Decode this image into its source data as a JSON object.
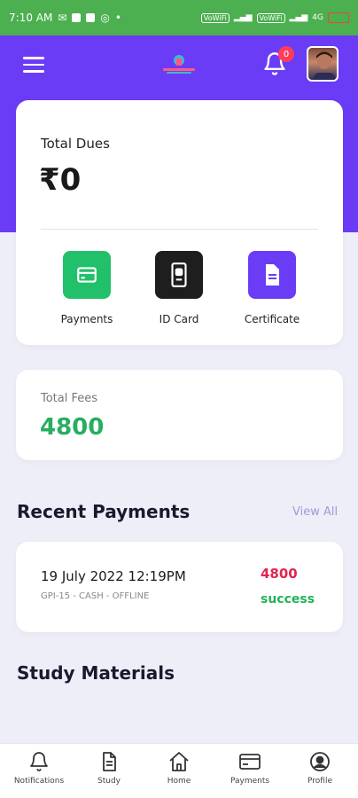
{
  "status_bar": {
    "time": "7:10 AM",
    "wifi_label_1": "VoWiFi",
    "wifi_label_2": "VoWiFi",
    "signal_label": "4G",
    "battery_color": "#f44336"
  },
  "header": {
    "accent_color": "#6b3cf5",
    "notification_count": "0",
    "menu_icon": "menu-icon",
    "notification_icon": "bell-icon"
  },
  "dues": {
    "label": "Total Dues",
    "value": "₹0",
    "actions": [
      {
        "label": "Payments",
        "icon": "credit-card-icon",
        "color": "#22c06a"
      },
      {
        "label": "ID Card",
        "icon": "id-card-icon",
        "color": "#1e1e1e"
      },
      {
        "label": "Certificate",
        "icon": "document-icon",
        "color": "#6b3cf5"
      }
    ]
  },
  "fees": {
    "label": "Total Fees",
    "value": "4800",
    "value_color": "#27ae60"
  },
  "recent_payments": {
    "title": "Recent Payments",
    "view_all": "View All",
    "items": [
      {
        "date": "19 July 2022 12:19PM",
        "meta": "GPI-15 - CASH - OFFLINE",
        "amount": "4800",
        "status": "success"
      }
    ]
  },
  "study_materials": {
    "title": "Study Materials"
  },
  "bottom_nav": {
    "items": [
      {
        "label": "Notifications",
        "icon": "bell-icon"
      },
      {
        "label": "Study",
        "icon": "document-icon"
      },
      {
        "label": "Home",
        "icon": "home-icon"
      },
      {
        "label": "Payments",
        "icon": "credit-card-icon"
      },
      {
        "label": "Profile",
        "icon": "profile-icon"
      }
    ]
  }
}
